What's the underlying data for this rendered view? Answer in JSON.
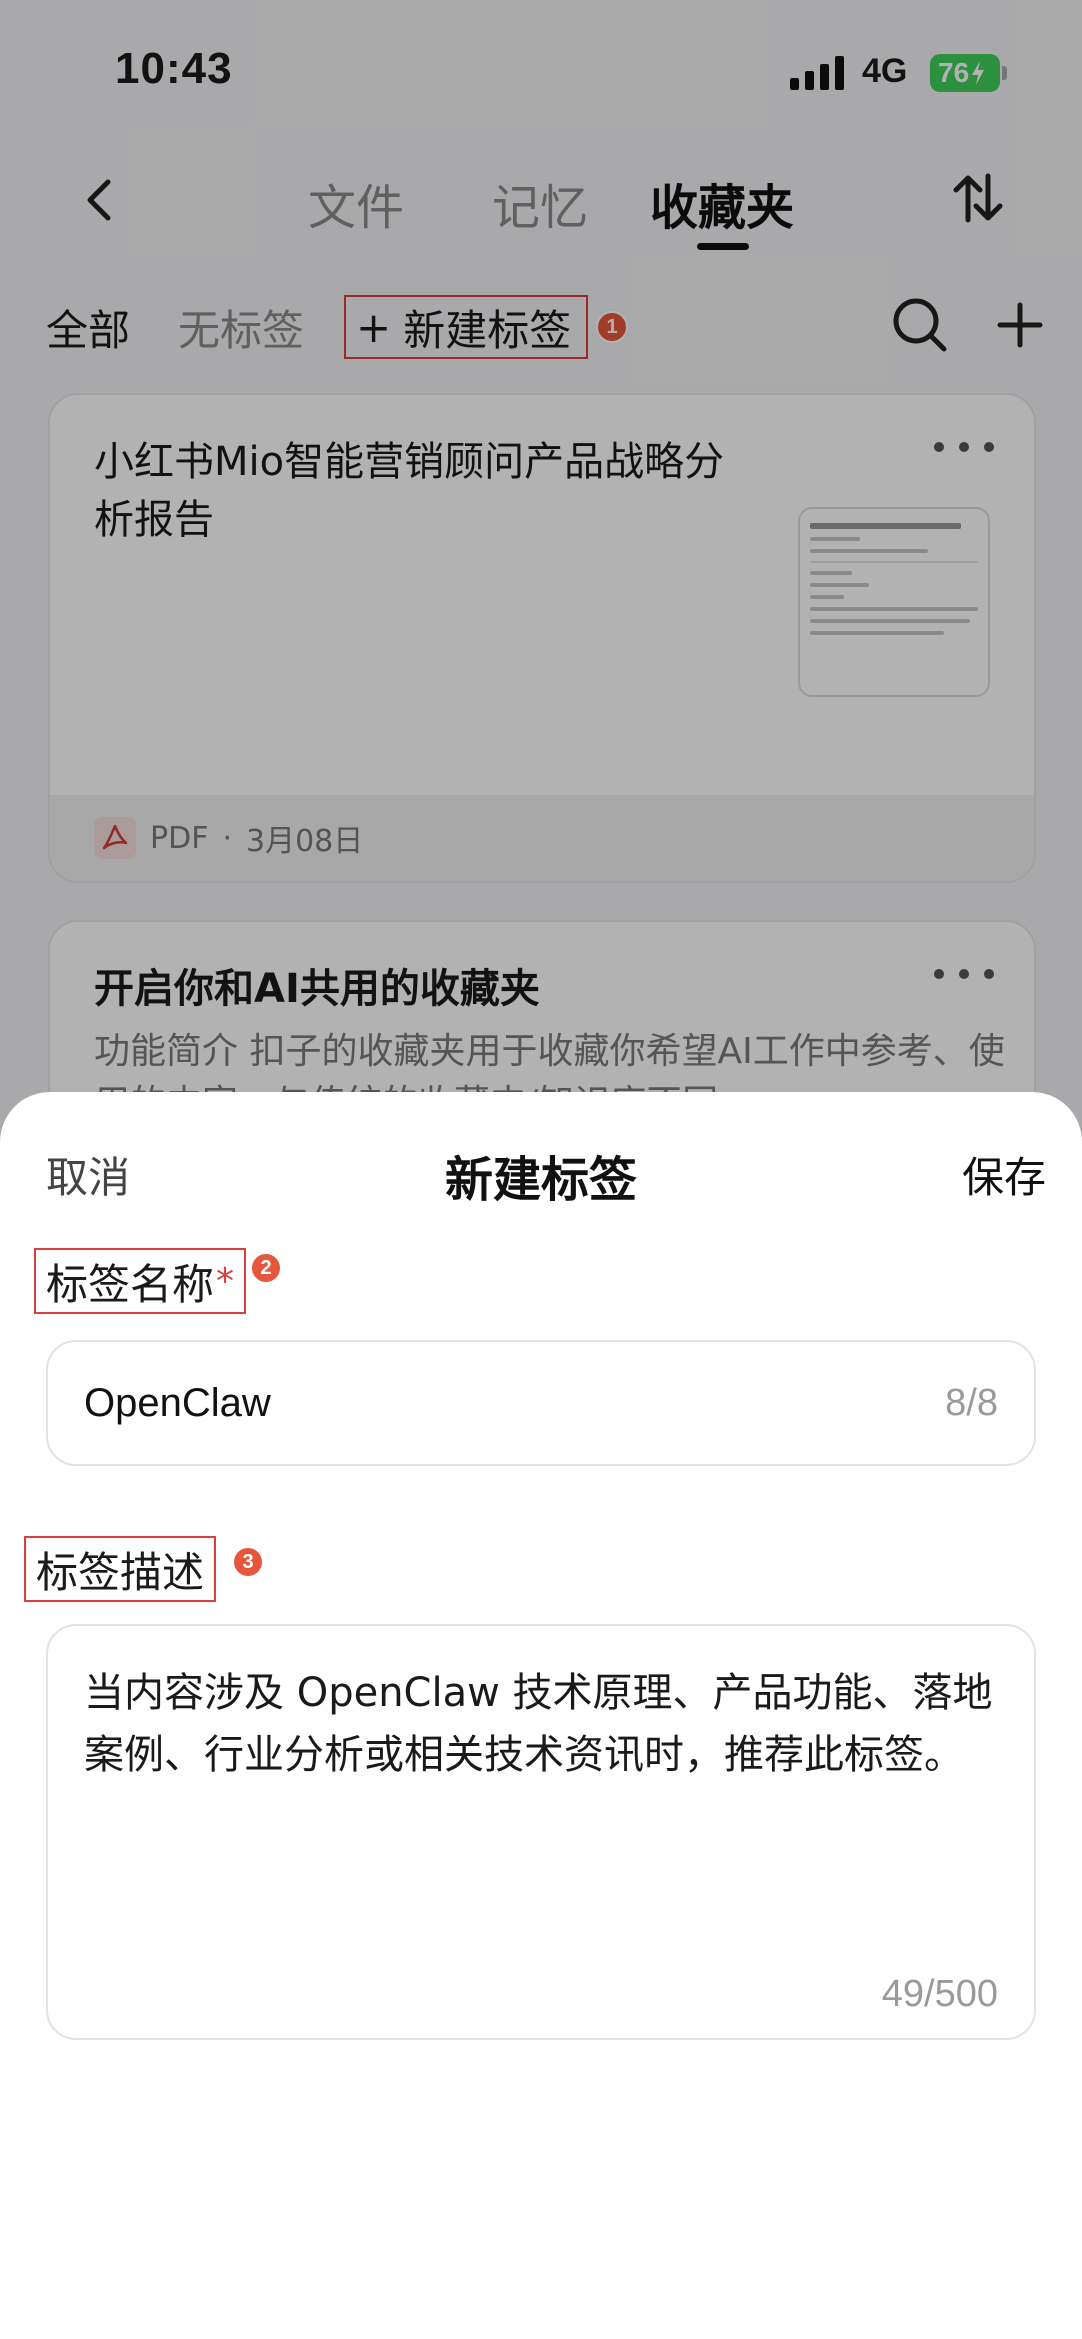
{
  "status_bar": {
    "time": "10:43",
    "network": "4G",
    "battery": "76"
  },
  "nav": {
    "tabs": [
      {
        "label": "文件"
      },
      {
        "label": "记忆"
      },
      {
        "label": "收藏夹"
      }
    ],
    "active_tab": "收藏夹"
  },
  "filters": {
    "all": "全部",
    "untagged": "无标签",
    "new_tag": "新建标签",
    "new_tag_plus": "+"
  },
  "annotations": {
    "one": "1",
    "two": "2",
    "three": "3"
  },
  "cards": [
    {
      "title": "小红书Mio智能营销顾问产品战略分析报告",
      "file_type": "PDF",
      "date": "3月08日",
      "separator": "·"
    },
    {
      "title": "开启你和AI共用的收藏夹",
      "description": "功能简介  扣子的收藏夹用于收藏你希望AI工作中参考、使用的内容。与传统的收藏夹/知识库不同"
    }
  ],
  "sheet": {
    "cancel": "取消",
    "title": "新建标签",
    "save": "保存",
    "name_label": "标签名称",
    "required_mark": "*",
    "name_value": "OpenClaw",
    "name_counter": "8/8",
    "desc_label": "标签描述",
    "desc_value": "当内容涉及 OpenClaw 技术原理、产品功能、落地案例、行业分析或相关技术资讯时，推荐此标签。",
    "desc_counter": "49/500"
  },
  "icons": {
    "back": "chevron-left-icon",
    "sort": "sort-arrows-icon",
    "search": "search-icon",
    "add": "plus-icon",
    "more": "more-dots-icon",
    "pdf": "pdf-icon"
  },
  "colors": {
    "accent_red": "#d94040",
    "badge": "#e4573d",
    "battery": "#3fcf5b"
  }
}
